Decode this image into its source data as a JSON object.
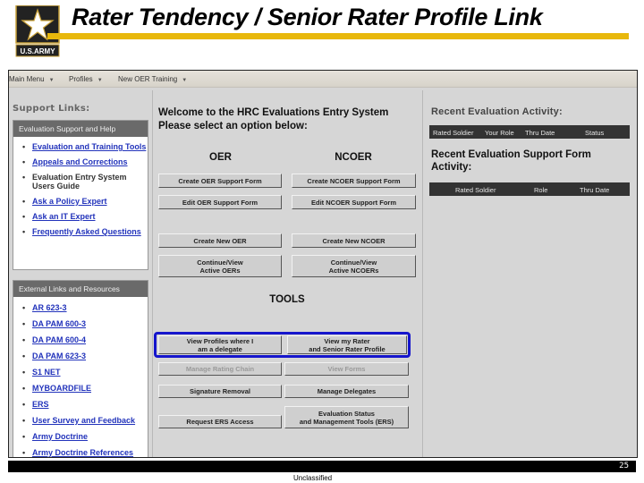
{
  "slide": {
    "title": "Rater Tendency / Senior Rater Profile Link",
    "logo_text": "U.S.ARMY",
    "logo_icon": "army-star-logo",
    "page_number": "25",
    "classification": "Unclassified",
    "accent_color": "#e8b80c",
    "highlight_color": "#1515cc"
  },
  "menubar": {
    "items": [
      {
        "label": "Main Menu"
      },
      {
        "label": "Profiles"
      },
      {
        "label": "New OER Training"
      }
    ]
  },
  "sidebar": {
    "support_label": "Support Links:",
    "support_box": {
      "header": "Evaluation Support and Help",
      "items": [
        {
          "label": "Evaluation and Training Tools",
          "link": true
        },
        {
          "label": "Appeals and Corrections",
          "link": true
        },
        {
          "label": "Evaluation Entry System Users Guide",
          "link": false
        },
        {
          "label": "Ask a Policy Expert",
          "link": true
        },
        {
          "label": "Ask an IT Expert",
          "link": true
        },
        {
          "label": "Frequently Asked Questions",
          "link": true
        }
      ]
    },
    "external_box": {
      "header": "External Links and Resources",
      "items": [
        {
          "label": "AR 623-3"
        },
        {
          "label": "DA PAM 600-3"
        },
        {
          "label": "DA PAM 600-4"
        },
        {
          "label": "DA PAM 623-3"
        },
        {
          "label": "S1 NET"
        },
        {
          "label": "MYBOARDFILE"
        },
        {
          "label": "ERS"
        },
        {
          "label": "User Survey and Feedback"
        },
        {
          "label": "Army Doctrine"
        },
        {
          "label": "Army Doctrine References"
        }
      ]
    }
  },
  "main": {
    "welcome_line1": "Welcome to the HRC Evaluations Entry System",
    "welcome_line2": "Please select an option below:",
    "oer_heading": "OER",
    "ncoer_heading": "NCOER",
    "tools_heading": "TOOLS",
    "buttons": {
      "create_oer_support": "Create OER Support Form",
      "create_ncoer_support": "Create NCOER Support Form",
      "edit_oer_support": "Edit OER Support Form",
      "edit_ncoer_support": "Edit NCOER Support Form",
      "create_new_oer": "Create New OER",
      "create_new_ncoer": "Create New NCOER",
      "continue_oers": "Continue/View\nActive OERs",
      "continue_ncoers": "Continue/View\nActive NCOERs",
      "view_delegate_profiles": "View Profiles where I\nam a delegate",
      "view_rater_profile": "View my Rater\nand Senior Rater Profile",
      "manage_rating_chain": "Manage Rating Chain",
      "view_forms": "View Forms",
      "signature_removal": "Signature Removal",
      "manage_delegates": "Manage Delegates",
      "request_ers_access": "Request ERS Access",
      "evaluation_status_tools": "Evaluation Status\nand Management Tools (ERS)"
    }
  },
  "right_panel": {
    "recent_activity_title": "Recent Evaluation Activity:",
    "recent_activity_columns": [
      "Rated Soldier",
      "Your Role",
      "Thru Date",
      "Status"
    ],
    "support_activity_title": "Recent Evaluation Support Form Activity:",
    "support_activity_columns": [
      "Rated Soldier",
      "Role",
      "Thru Date"
    ]
  }
}
